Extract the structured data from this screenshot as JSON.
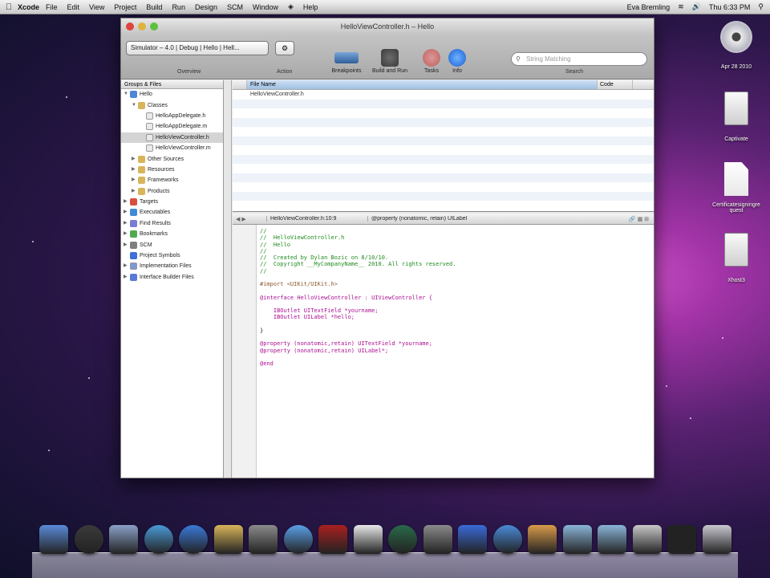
{
  "menubar": {
    "app_name": "Xcode",
    "items": [
      "File",
      "Edit",
      "View",
      "Project",
      "Build",
      "Run",
      "Design",
      "SCM",
      "Window",
      "Help"
    ],
    "user": "Eva Bremling",
    "clock": "Thu 6:33 PM"
  },
  "window": {
    "title": "HelloViewController.h – Hello",
    "toolbar": {
      "overview_value": "Simulator – 4.0 | Debug | Hello | Hell...",
      "overview_label": "Overview",
      "action_label": "Action",
      "breakpoints_label": "Breakpoints",
      "build_run_label": "Build and Run",
      "tasks_label": "Tasks",
      "info_label": "Info",
      "search_placeholder": "String Matching",
      "search_label": "Search"
    },
    "sidebar": {
      "header": "Groups & Files",
      "items": [
        {
          "label": "Hello",
          "indent": 0,
          "icon": "project-icon",
          "expand": "down",
          "selected": false
        },
        {
          "label": "Classes",
          "indent": 1,
          "icon": "folder-icon",
          "expand": "down",
          "selected": false
        },
        {
          "label": "HelloAppDelegate.h",
          "indent": 2,
          "icon": "header-file-icon",
          "expand": "",
          "selected": false
        },
        {
          "label": "HelloAppDelegate.m",
          "indent": 2,
          "icon": "source-file-icon",
          "expand": "",
          "selected": false
        },
        {
          "label": "HelloViewController.h",
          "indent": 2,
          "icon": "header-file-icon",
          "expand": "",
          "selected": true
        },
        {
          "label": "HelloViewController.m",
          "indent": 2,
          "icon": "source-file-icon",
          "expand": "",
          "selected": false
        },
        {
          "label": "Other Sources",
          "indent": 1,
          "icon": "folder-icon",
          "expand": "right",
          "selected": false
        },
        {
          "label": "Resources",
          "indent": 1,
          "icon": "folder-icon",
          "expand": "right",
          "selected": false
        },
        {
          "label": "Frameworks",
          "indent": 1,
          "icon": "folder-icon",
          "expand": "right",
          "selected": false
        },
        {
          "label": "Products",
          "indent": 1,
          "icon": "folder-icon",
          "expand": "right",
          "selected": false
        },
        {
          "label": "Targets",
          "indent": 0,
          "icon": "target-icon",
          "expand": "right",
          "selected": false
        },
        {
          "label": "Executables",
          "indent": 0,
          "icon": "executable-icon",
          "expand": "right",
          "selected": false
        },
        {
          "label": "Find Results",
          "indent": 0,
          "icon": "search-icon",
          "expand": "right",
          "selected": false
        },
        {
          "label": "Bookmarks",
          "indent": 0,
          "icon": "bookmark-icon",
          "expand": "right",
          "selected": false
        },
        {
          "label": "SCM",
          "indent": 0,
          "icon": "scm-icon",
          "expand": "right",
          "selected": false
        },
        {
          "label": "Project Symbols",
          "indent": 0,
          "icon": "symbols-icon",
          "expand": "",
          "selected": false
        },
        {
          "label": "Implementation Files",
          "indent": 0,
          "icon": "files-icon",
          "expand": "right",
          "selected": false
        },
        {
          "label": "Interface Builder Files",
          "indent": 0,
          "icon": "nib-icon",
          "expand": "right",
          "selected": false
        }
      ]
    },
    "detail": {
      "columns": [
        "File Name",
        "Code"
      ],
      "rows": [
        "HelloViewController.h"
      ]
    },
    "editor": {
      "file_popup": "HelloViewController.h:10:9",
      "symbol_popup": "@property (nonatomic, retain) UILabel",
      "lines": [
        {
          "cls": "cm",
          "text": "//"
        },
        {
          "cls": "cm",
          "text": "//  HelloViewController.h"
        },
        {
          "cls": "cm",
          "text": "//  Hello"
        },
        {
          "cls": "cm",
          "text": "//"
        },
        {
          "cls": "cm",
          "text": "//  Created by Dylan Bozic on 8/10/10."
        },
        {
          "cls": "cm",
          "text": "//  Copyright __MyCompanyName__ 2010. All rights reserved."
        },
        {
          "cls": "cm",
          "text": "//"
        },
        {
          "cls": "plain",
          "text": ""
        },
        {
          "cls": "dir",
          "text": "#import <UIKit/UIKit.h>"
        },
        {
          "cls": "plain",
          "text": ""
        },
        {
          "cls": "kw",
          "text": "@interface HelloViewController : UIViewController {"
        },
        {
          "cls": "plain",
          "text": ""
        },
        {
          "cls": "kw",
          "text": "    IBOutlet UITextField *yourname;"
        },
        {
          "cls": "kw",
          "text": "    IBOutlet UILabel *hello;"
        },
        {
          "cls": "plain",
          "text": ""
        },
        {
          "cls": "plain",
          "text": "}"
        },
        {
          "cls": "plain",
          "text": ""
        },
        {
          "cls": "kw",
          "text": "@property (nonatomic,retain) UITextField *yourname;"
        },
        {
          "cls": "kw",
          "text": "@property (nonatomic,retain) UILabel*;"
        },
        {
          "cls": "plain",
          "text": ""
        },
        {
          "cls": "kw",
          "text": "@end"
        }
      ]
    }
  },
  "desktop": {
    "icons": [
      {
        "label": "Apr 28 2010",
        "kind": "cd"
      },
      {
        "label": "Captivate",
        "kind": "disk"
      },
      {
        "label": "Certificatesigningrequest",
        "kind": "doc"
      },
      {
        "label": "Xhost3",
        "kind": "disk"
      }
    ]
  },
  "dock": {
    "apps": [
      "finder-icon",
      "dashboard-icon",
      "preview-icon",
      "safari-icon",
      "ichat-icon",
      "address-book-icon",
      "iphoto-icon",
      "itunes-icon",
      "photo-booth-icon",
      "ical-icon",
      "time-machine-icon",
      "system-preferences-icon",
      "xcode-icon",
      "instruments-icon",
      "ibooks-icon",
      "applications-folder-icon",
      "documents-folder-icon",
      "downloads-stack-icon",
      "terminal-icon",
      "trash-icon"
    ]
  }
}
